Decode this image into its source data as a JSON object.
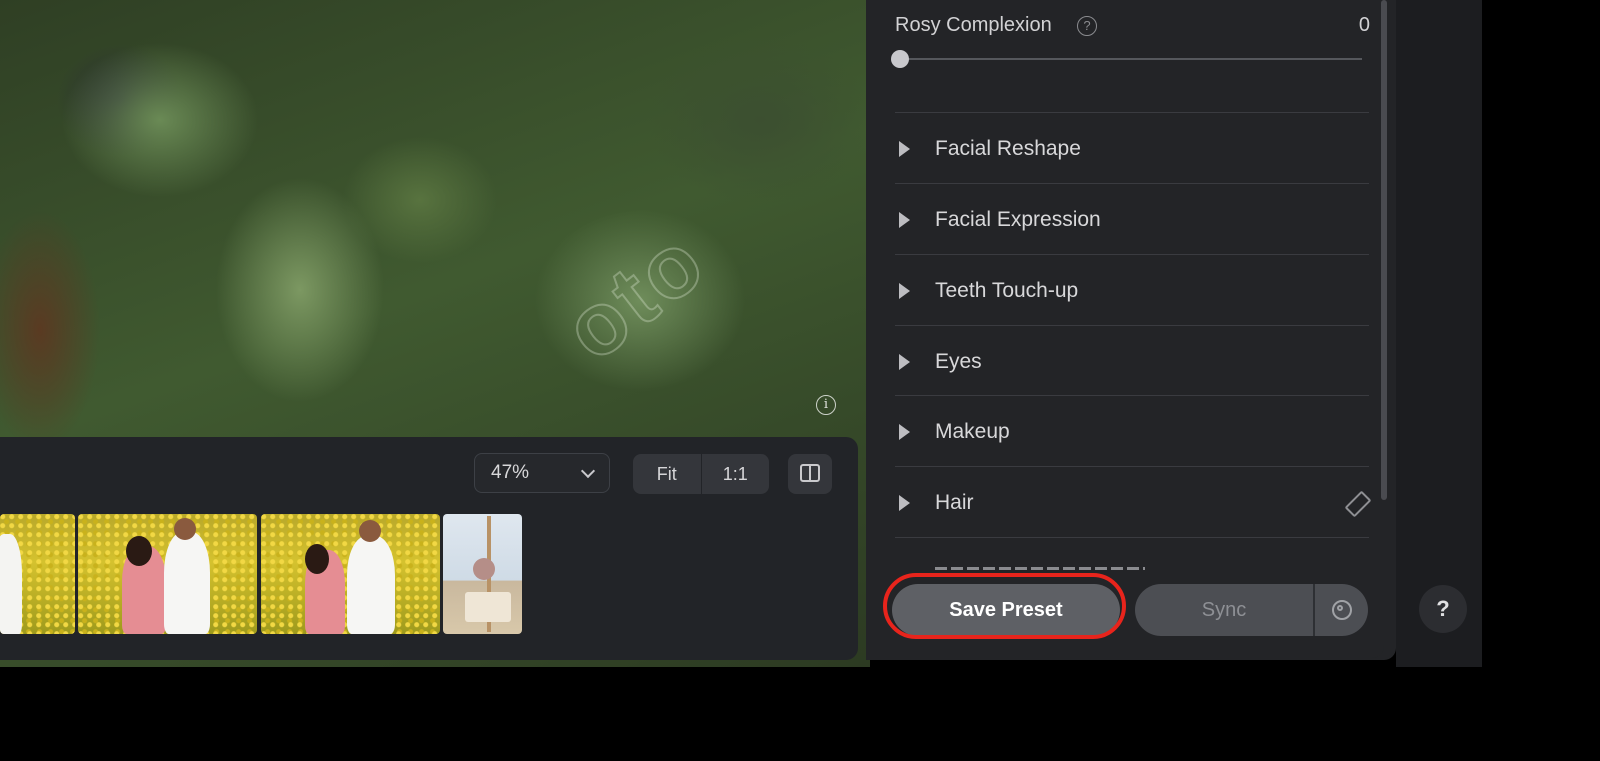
{
  "canvas": {
    "watermark_text": "oto",
    "info_icon": "info-icon"
  },
  "toolbar": {
    "zoom_value": "47%",
    "fit_label": "Fit",
    "one_to_one_label": "1:1",
    "compare_icon": "split-compare-icon"
  },
  "filmstrip": {
    "thumbnails": [
      "couple-field-1",
      "couple-field-2",
      "couple-field-3",
      "woman-easel-beach"
    ]
  },
  "panel": {
    "slider": {
      "label": "Rosy Complexion",
      "value": "0",
      "help_icon": "help-icon",
      "level": 0
    },
    "sections": [
      {
        "label": "Facial Reshape"
      },
      {
        "label": "Facial Expression"
      },
      {
        "label": "Teeth Touch-up"
      },
      {
        "label": "Eyes"
      },
      {
        "label": "Makeup"
      },
      {
        "label": "Hair"
      }
    ],
    "hair_icon": "eraser-icon"
  },
  "footer": {
    "save_preset_label": "Save Preset",
    "sync_label": "Sync",
    "sync_settings_icon": "gear-icon",
    "help_label": "?",
    "highlight_color": "#e8241c"
  }
}
